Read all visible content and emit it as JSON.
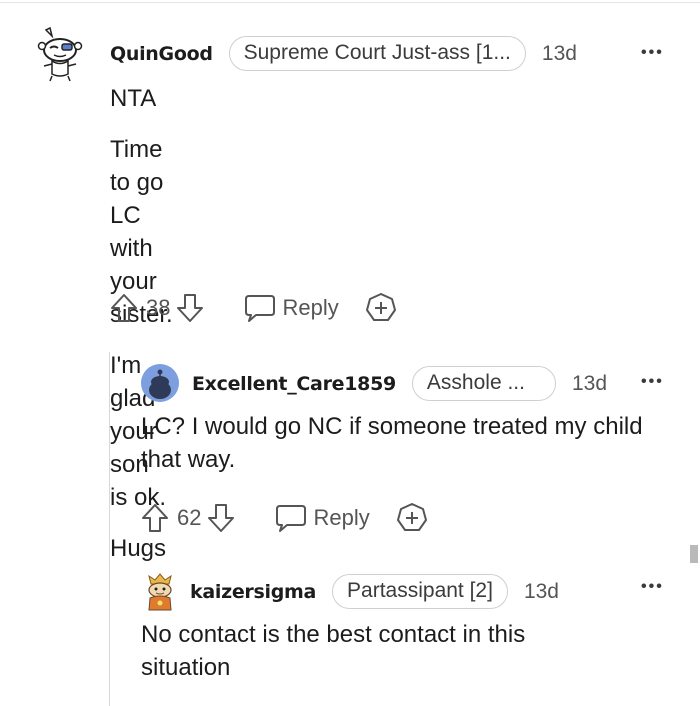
{
  "comments": [
    {
      "username": "QuinGood",
      "flair": "Supreme Court Just-ass [1...",
      "time": "13d",
      "more": "•••",
      "lines": [
        "NTA",
        "Time to go LC with your sister.",
        "I'm glad your son is ok.",
        "Hugs"
      ],
      "votes": "38",
      "reply": "Reply"
    },
    {
      "username": "Excellent_Care1859",
      "flair": "Asshole ...",
      "time": "13d",
      "more": "•••",
      "text": "LC? I would go NC if someone treated my child that way.",
      "votes": "62",
      "reply": "Reply"
    },
    {
      "username": "kaizersigma",
      "flair": "Partassipant [2]",
      "time": "13d",
      "more": "•••",
      "text": "No contact is the best contact in this situation"
    }
  ],
  "icons": {
    "upvote": "upvote-arrow-icon",
    "downvote": "downvote-arrow-icon",
    "reply": "speech-bubble-icon",
    "award": "award-plus-icon"
  },
  "colors": {
    "text": "#1c1c1c",
    "muted": "#555555",
    "border": "#cfcfcf",
    "avatar_blue": "#6a8fd8"
  }
}
